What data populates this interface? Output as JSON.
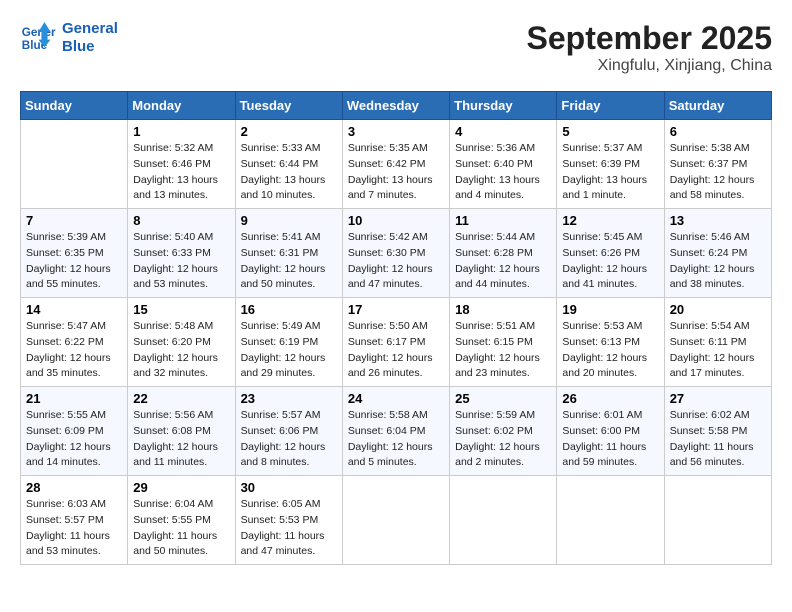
{
  "header": {
    "logo_line1": "General",
    "logo_line2": "Blue",
    "title": "September 2025",
    "subtitle": "Xingfulu, Xinjiang, China"
  },
  "weekdays": [
    "Sunday",
    "Monday",
    "Tuesday",
    "Wednesday",
    "Thursday",
    "Friday",
    "Saturday"
  ],
  "weeks": [
    [
      {
        "day": "",
        "info": ""
      },
      {
        "day": "1",
        "info": "Sunrise: 5:32 AM\nSunset: 6:46 PM\nDaylight: 13 hours\nand 13 minutes."
      },
      {
        "day": "2",
        "info": "Sunrise: 5:33 AM\nSunset: 6:44 PM\nDaylight: 13 hours\nand 10 minutes."
      },
      {
        "day": "3",
        "info": "Sunrise: 5:35 AM\nSunset: 6:42 PM\nDaylight: 13 hours\nand 7 minutes."
      },
      {
        "day": "4",
        "info": "Sunrise: 5:36 AM\nSunset: 6:40 PM\nDaylight: 13 hours\nand 4 minutes."
      },
      {
        "day": "5",
        "info": "Sunrise: 5:37 AM\nSunset: 6:39 PM\nDaylight: 13 hours\nand 1 minute."
      },
      {
        "day": "6",
        "info": "Sunrise: 5:38 AM\nSunset: 6:37 PM\nDaylight: 12 hours\nand 58 minutes."
      }
    ],
    [
      {
        "day": "7",
        "info": "Sunrise: 5:39 AM\nSunset: 6:35 PM\nDaylight: 12 hours\nand 55 minutes."
      },
      {
        "day": "8",
        "info": "Sunrise: 5:40 AM\nSunset: 6:33 PM\nDaylight: 12 hours\nand 53 minutes."
      },
      {
        "day": "9",
        "info": "Sunrise: 5:41 AM\nSunset: 6:31 PM\nDaylight: 12 hours\nand 50 minutes."
      },
      {
        "day": "10",
        "info": "Sunrise: 5:42 AM\nSunset: 6:30 PM\nDaylight: 12 hours\nand 47 minutes."
      },
      {
        "day": "11",
        "info": "Sunrise: 5:44 AM\nSunset: 6:28 PM\nDaylight: 12 hours\nand 44 minutes."
      },
      {
        "day": "12",
        "info": "Sunrise: 5:45 AM\nSunset: 6:26 PM\nDaylight: 12 hours\nand 41 minutes."
      },
      {
        "day": "13",
        "info": "Sunrise: 5:46 AM\nSunset: 6:24 PM\nDaylight: 12 hours\nand 38 minutes."
      }
    ],
    [
      {
        "day": "14",
        "info": "Sunrise: 5:47 AM\nSunset: 6:22 PM\nDaylight: 12 hours\nand 35 minutes."
      },
      {
        "day": "15",
        "info": "Sunrise: 5:48 AM\nSunset: 6:20 PM\nDaylight: 12 hours\nand 32 minutes."
      },
      {
        "day": "16",
        "info": "Sunrise: 5:49 AM\nSunset: 6:19 PM\nDaylight: 12 hours\nand 29 minutes."
      },
      {
        "day": "17",
        "info": "Sunrise: 5:50 AM\nSunset: 6:17 PM\nDaylight: 12 hours\nand 26 minutes."
      },
      {
        "day": "18",
        "info": "Sunrise: 5:51 AM\nSunset: 6:15 PM\nDaylight: 12 hours\nand 23 minutes."
      },
      {
        "day": "19",
        "info": "Sunrise: 5:53 AM\nSunset: 6:13 PM\nDaylight: 12 hours\nand 20 minutes."
      },
      {
        "day": "20",
        "info": "Sunrise: 5:54 AM\nSunset: 6:11 PM\nDaylight: 12 hours\nand 17 minutes."
      }
    ],
    [
      {
        "day": "21",
        "info": "Sunrise: 5:55 AM\nSunset: 6:09 PM\nDaylight: 12 hours\nand 14 minutes."
      },
      {
        "day": "22",
        "info": "Sunrise: 5:56 AM\nSunset: 6:08 PM\nDaylight: 12 hours\nand 11 minutes."
      },
      {
        "day": "23",
        "info": "Sunrise: 5:57 AM\nSunset: 6:06 PM\nDaylight: 12 hours\nand 8 minutes."
      },
      {
        "day": "24",
        "info": "Sunrise: 5:58 AM\nSunset: 6:04 PM\nDaylight: 12 hours\nand 5 minutes."
      },
      {
        "day": "25",
        "info": "Sunrise: 5:59 AM\nSunset: 6:02 PM\nDaylight: 12 hours\nand 2 minutes."
      },
      {
        "day": "26",
        "info": "Sunrise: 6:01 AM\nSunset: 6:00 PM\nDaylight: 11 hours\nand 59 minutes."
      },
      {
        "day": "27",
        "info": "Sunrise: 6:02 AM\nSunset: 5:58 PM\nDaylight: 11 hours\nand 56 minutes."
      }
    ],
    [
      {
        "day": "28",
        "info": "Sunrise: 6:03 AM\nSunset: 5:57 PM\nDaylight: 11 hours\nand 53 minutes."
      },
      {
        "day": "29",
        "info": "Sunrise: 6:04 AM\nSunset: 5:55 PM\nDaylight: 11 hours\nand 50 minutes."
      },
      {
        "day": "30",
        "info": "Sunrise: 6:05 AM\nSunset: 5:53 PM\nDaylight: 11 hours\nand 47 minutes."
      },
      {
        "day": "",
        "info": ""
      },
      {
        "day": "",
        "info": ""
      },
      {
        "day": "",
        "info": ""
      },
      {
        "day": "",
        "info": ""
      }
    ]
  ]
}
